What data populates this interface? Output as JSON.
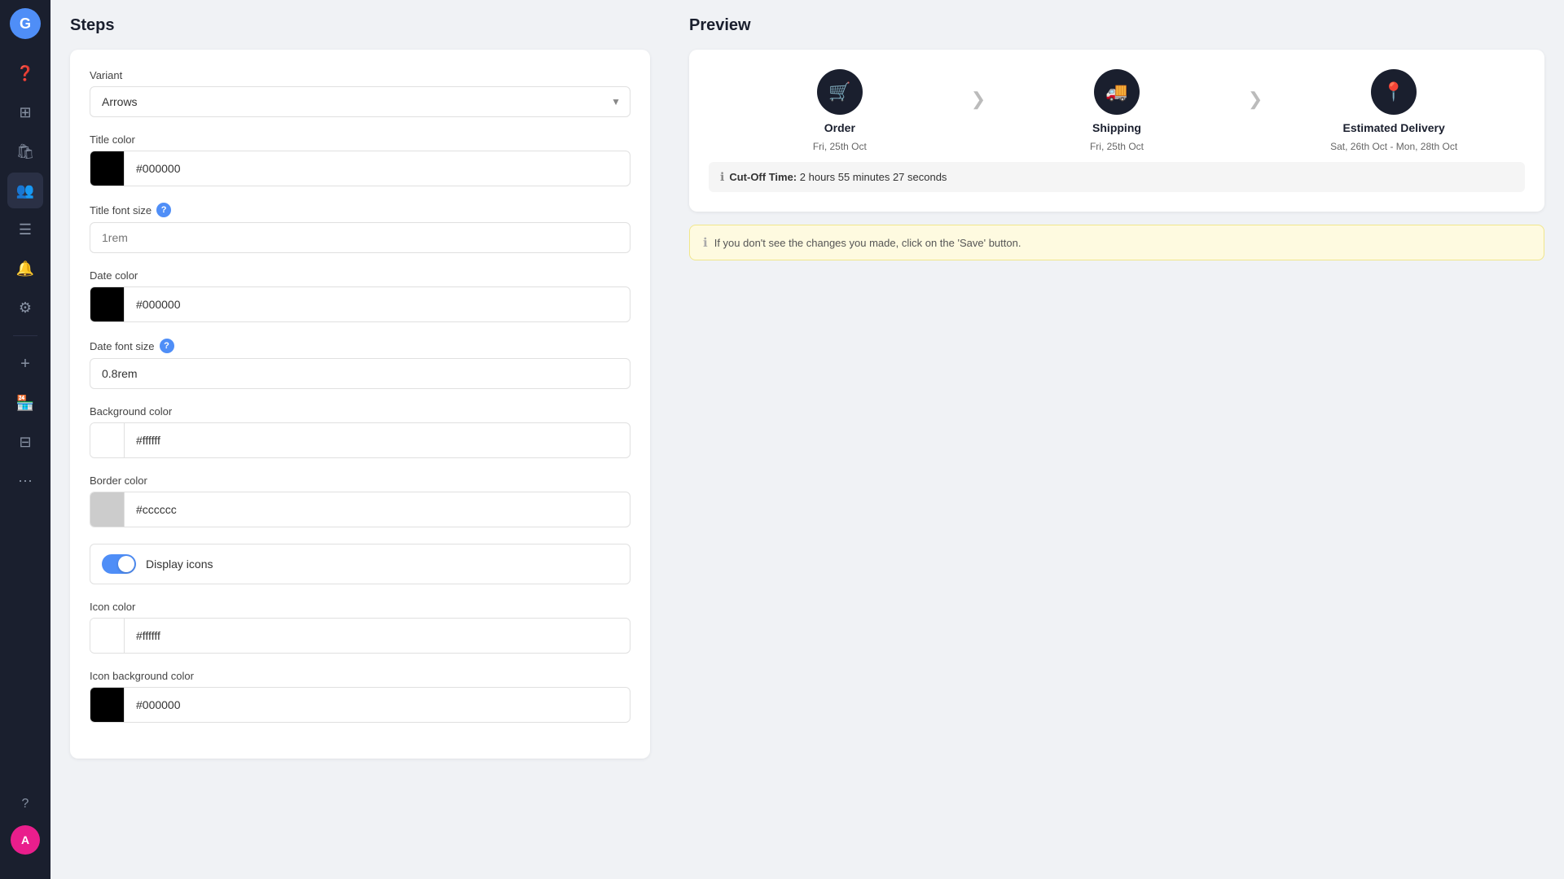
{
  "sidebar": {
    "logo_letter": "G",
    "items": [
      {
        "id": "help",
        "icon": "❓"
      },
      {
        "id": "grid",
        "icon": "⊞"
      },
      {
        "id": "bag",
        "icon": "🛍"
      },
      {
        "id": "users",
        "icon": "👥"
      },
      {
        "id": "list",
        "icon": "☰"
      },
      {
        "id": "bell",
        "icon": "🔔"
      },
      {
        "id": "gear",
        "icon": "⚙"
      },
      {
        "id": "plus",
        "icon": "+"
      },
      {
        "id": "shop",
        "icon": "🏪"
      },
      {
        "id": "table",
        "icon": "⊟"
      },
      {
        "id": "more",
        "icon": "⋯"
      }
    ],
    "bottom": [
      {
        "id": "question",
        "icon": "?"
      }
    ],
    "avatar_letter": "A"
  },
  "steps_panel": {
    "title": "Steps",
    "variant_label": "Variant",
    "variant_value": "Arrows",
    "variant_placeholder": "Arrows",
    "title_color_label": "Title color",
    "title_color_value": "#000000",
    "title_color_swatch": "black",
    "title_font_size_label": "Title font size",
    "title_font_size_placeholder": "1rem",
    "title_font_size_value": "",
    "date_color_label": "Date color",
    "date_color_value": "#000000",
    "date_color_swatch": "black",
    "date_font_size_label": "Date font size",
    "date_font_size_placeholder": "0.8rem",
    "date_font_size_value": "0.8rem",
    "background_color_label": "Background color",
    "background_color_value": "#ffffff",
    "background_color_swatch": "white",
    "border_color_label": "Border color",
    "border_color_value": "#cccccc",
    "border_color_swatch": "light-gray",
    "display_icons_label": "Display icons",
    "display_icons_enabled": true,
    "icon_color_label": "Icon color",
    "icon_color_value": "#ffffff",
    "icon_color_swatch": "white",
    "icon_bg_color_label": "Icon background color",
    "icon_bg_color_value": "#000000",
    "icon_bg_color_swatch": "black"
  },
  "preview": {
    "title": "Preview",
    "steps": [
      {
        "icon": "🛒",
        "name": "Order",
        "date": "Fri, 25th Oct"
      },
      {
        "icon": "🚚",
        "name": "Shipping",
        "date": "Fri, 25th Oct"
      },
      {
        "icon": "📍",
        "name": "Estimated Delivery",
        "date": "Sat, 26th Oct - Mon, 28th Oct"
      }
    ],
    "cutoff_prefix": "Cut-Off Time:",
    "cutoff_value": "2 hours 55 minutes 27 seconds",
    "info_message": "If you don't see the changes you made, click on the 'Save' button."
  }
}
